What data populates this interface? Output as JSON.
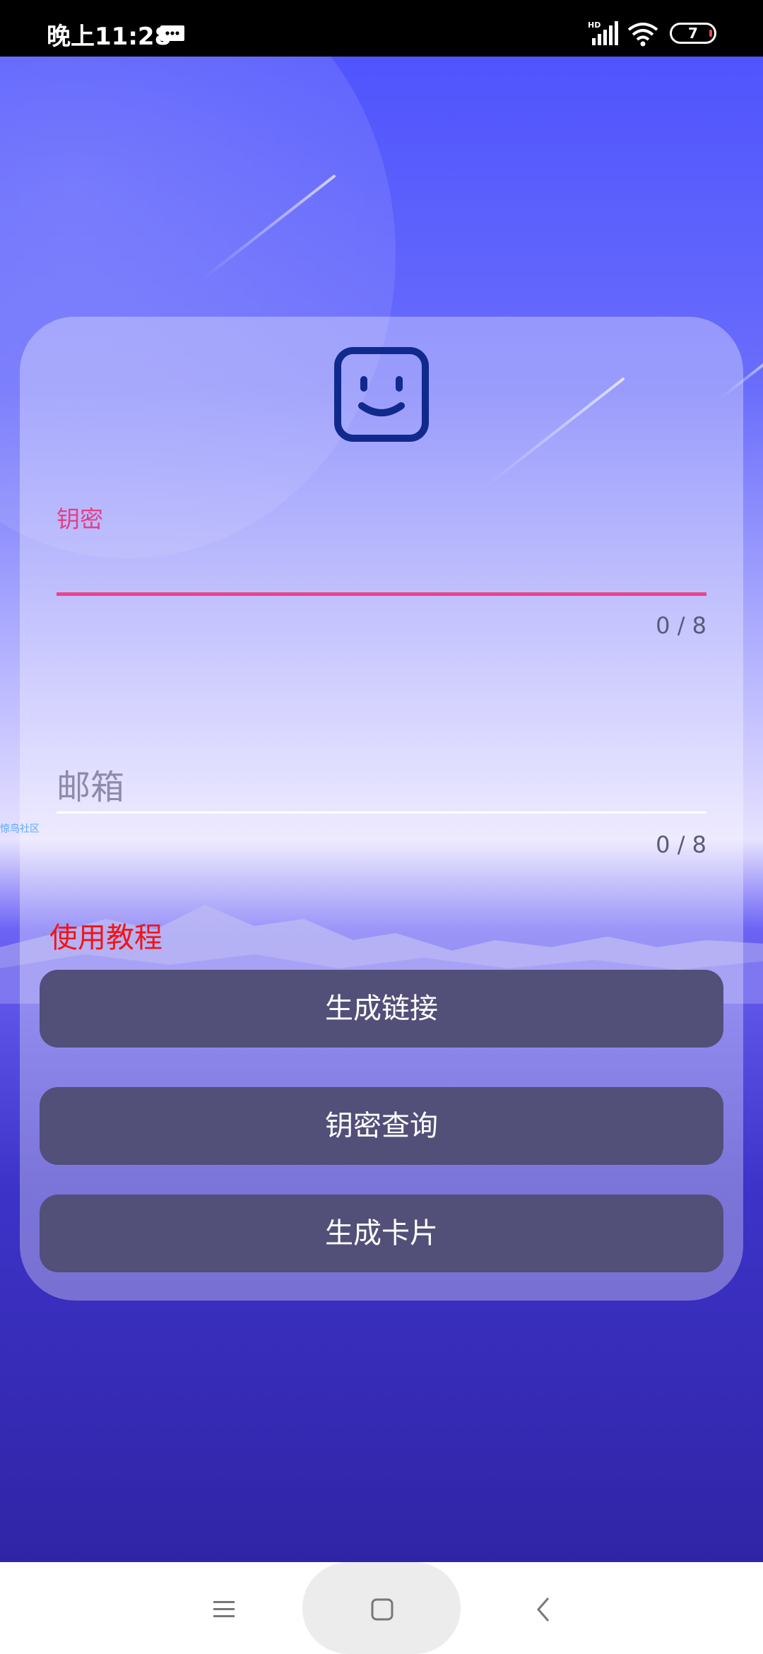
{
  "status_bar": {
    "time": "晚上11:28",
    "battery_level": "7",
    "icons": [
      "message-icon",
      "hd-signal-icon",
      "wifi-icon",
      "battery-icon"
    ]
  },
  "form": {
    "key_field": {
      "label": "钥密",
      "value": "",
      "counter": "0 / 8"
    },
    "email_field": {
      "placeholder": "邮箱",
      "value": "",
      "counter": "0 / 8"
    },
    "tutorial_link": "使用教程"
  },
  "buttons": {
    "generate_link": "生成链接",
    "query_key": "钥密查询",
    "generate_card": "生成卡片"
  },
  "watermark": "惊鸟社区",
  "colors": {
    "accent_pink": "#e8438a",
    "link_red": "#f21414",
    "button_bg": "#524f78",
    "bg_top": "#4f54fd",
    "bg_bottom": "#3024a6"
  },
  "nav_bar": {
    "icons": [
      "menu-icon",
      "home-icon",
      "back-icon"
    ]
  }
}
